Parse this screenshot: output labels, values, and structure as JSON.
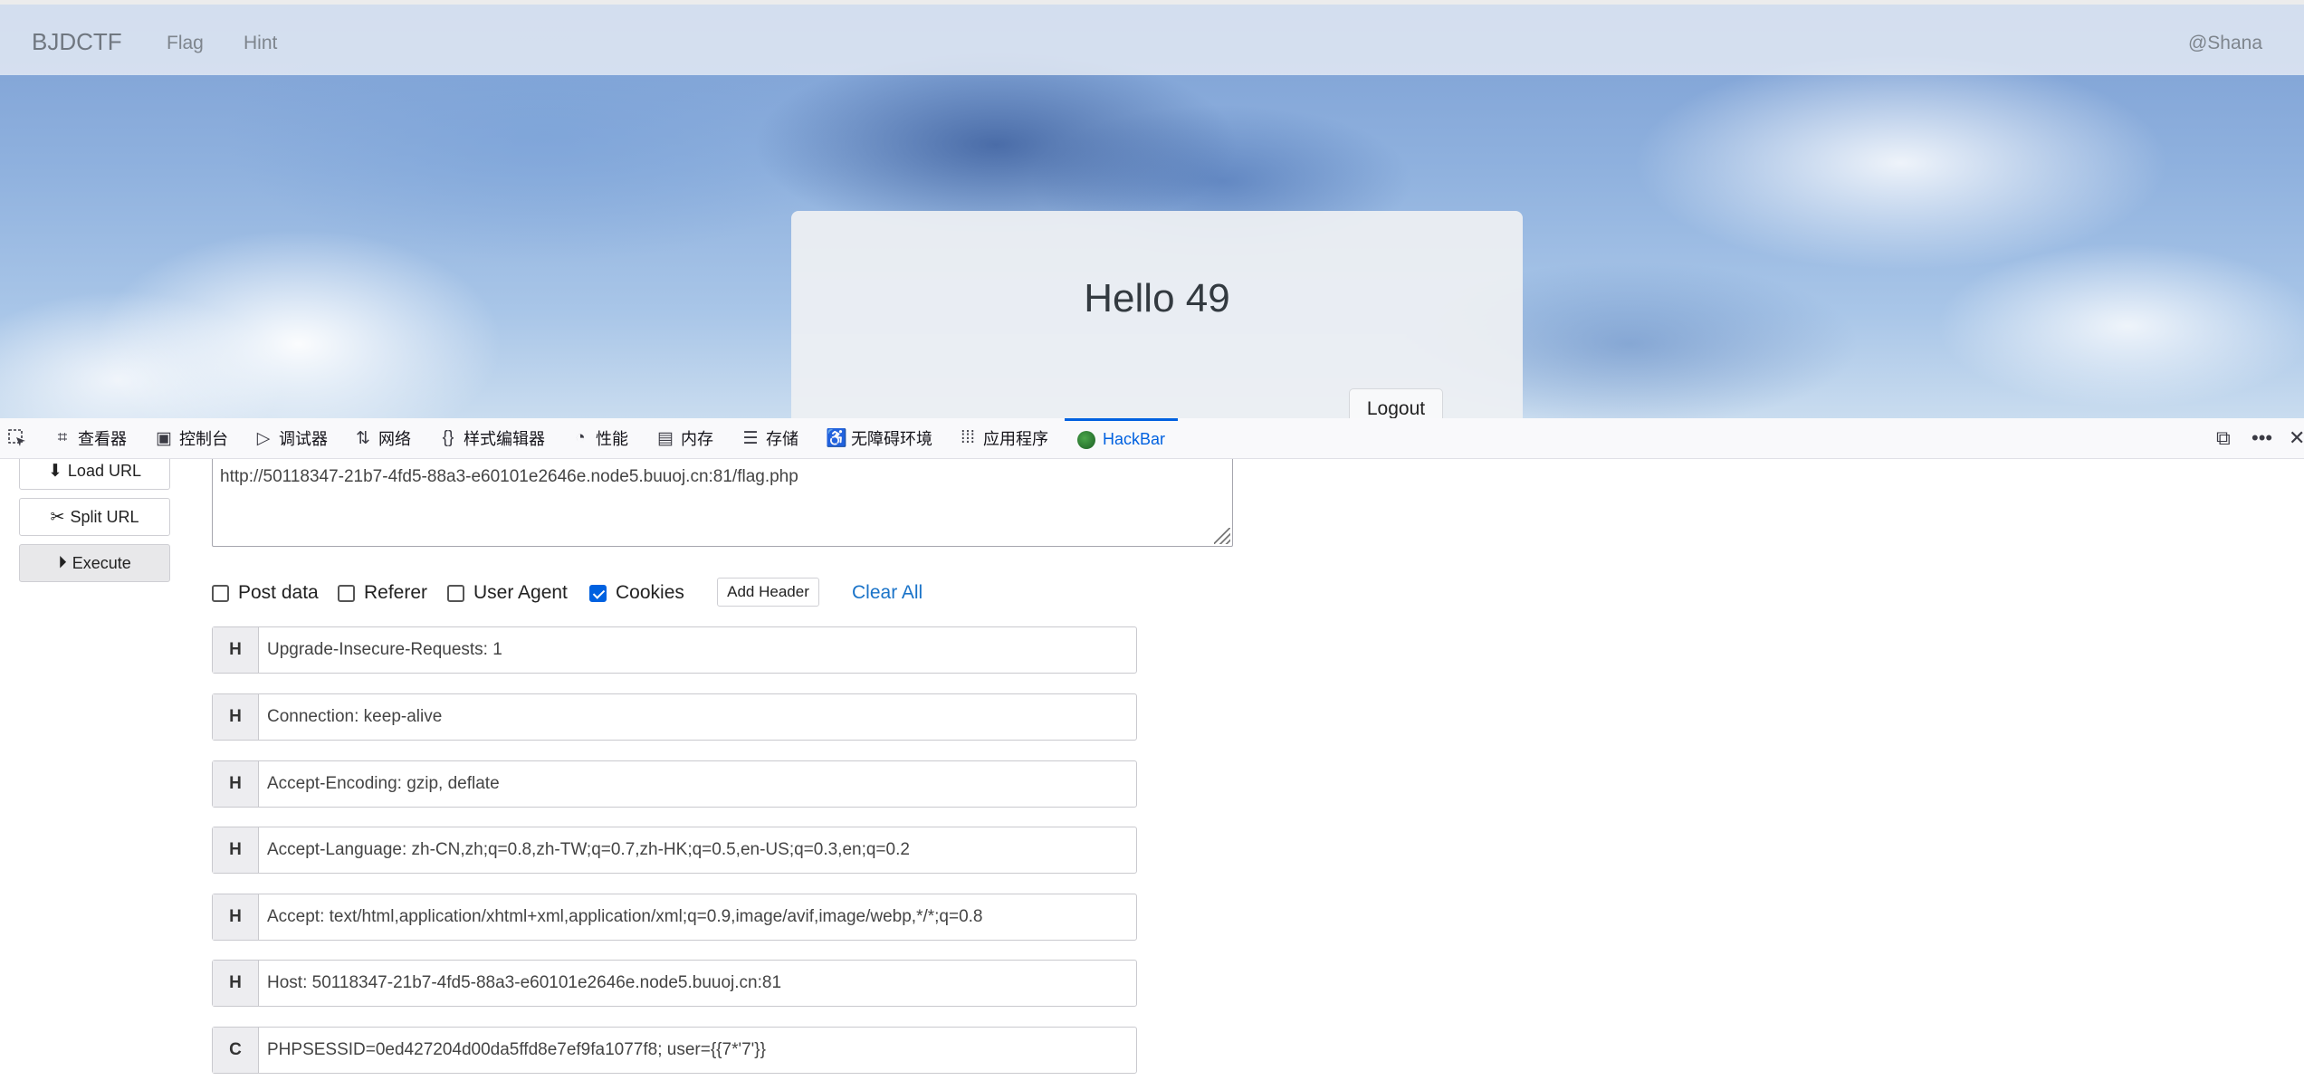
{
  "site": {
    "brand": "BJDCTF",
    "nav_links": [
      "Flag",
      "Hint"
    ],
    "user": "@Shana",
    "card_title": "Hello 49",
    "logout_label": "Logout"
  },
  "devtools": {
    "tabs": [
      {
        "icon": "inspector-icon",
        "label": "查看器"
      },
      {
        "icon": "console-icon",
        "label": "控制台"
      },
      {
        "icon": "debugger-icon",
        "label": "调试器"
      },
      {
        "icon": "network-icon",
        "label": "网络"
      },
      {
        "icon": "style-editor-icon",
        "label": "样式编辑器"
      },
      {
        "icon": "performance-icon",
        "label": "性能"
      },
      {
        "icon": "memory-icon",
        "label": "内存"
      },
      {
        "icon": "storage-icon",
        "label": "存储"
      },
      {
        "icon": "accessibility-icon",
        "label": "无障碍环境"
      },
      {
        "icon": "application-icon",
        "label": "应用程序"
      },
      {
        "icon": "hackbar-icon",
        "label": "HackBar",
        "active": true
      }
    ],
    "accent_color": "#0061e0"
  },
  "hackbar": {
    "buttons": {
      "load_url": "Load URL",
      "split_url": "Split URL",
      "execute": "Execute"
    },
    "url": "http://50118347-21b7-4fd5-88a3-e60101e2646e.node5.buuoj.cn:81/flag.php",
    "options": [
      {
        "label": "Post data",
        "checked": false
      },
      {
        "label": "Referer",
        "checked": false
      },
      {
        "label": "User Agent",
        "checked": false
      },
      {
        "label": "Cookies",
        "checked": true
      }
    ],
    "add_header_label": "Add Header",
    "clear_all_label": "Clear All",
    "headers": [
      {
        "tag": "H",
        "value": "Upgrade-Insecure-Requests: 1"
      },
      {
        "tag": "H",
        "value": "Connection: keep-alive"
      },
      {
        "tag": "H",
        "value": "Accept-Encoding: gzip, deflate"
      },
      {
        "tag": "H",
        "value": "Accept-Language: zh-CN,zh;q=0.8,zh-TW;q=0.7,zh-HK;q=0.5,en-US;q=0.3,en;q=0.2"
      },
      {
        "tag": "H",
        "value": "Accept: text/html,application/xhtml+xml,application/xml;q=0.9,image/avif,image/webp,*/*;q=0.8"
      },
      {
        "tag": "H",
        "value": "Host: 50118347-21b7-4fd5-88a3-e60101e2646e.node5.buuoj.cn:81"
      },
      {
        "tag": "C",
        "value": "PHPSESSID=0ed427204d00da5ffd8e7ef9fa1077f8; user={{7*'7'}}"
      }
    ]
  }
}
